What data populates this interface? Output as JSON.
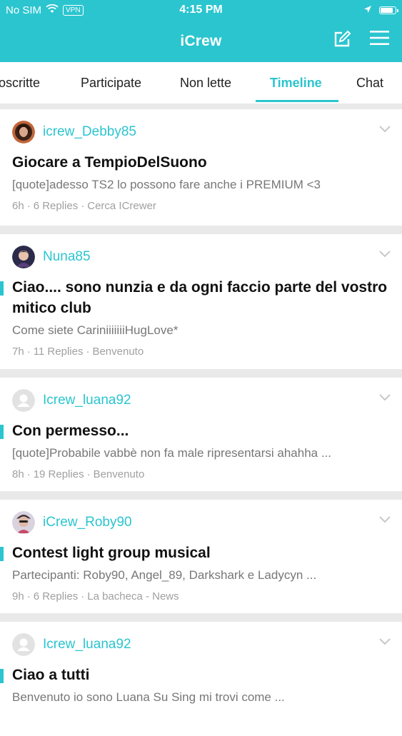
{
  "status_bar": {
    "carrier": "No SIM",
    "vpn": "VPN",
    "time": "4:15 PM",
    "battery_level": 0.75
  },
  "nav": {
    "title": "iCrew",
    "compose_icon": "compose-icon",
    "menu_icon": "hamburger-menu-icon"
  },
  "tabs": [
    "Iscritte",
    "Participate",
    "Non lette",
    "Timeline",
    "Chat"
  ],
  "tabs_display": [
    "oscritte",
    "Participate",
    "Non lette",
    "Timeline",
    "Chat"
  ],
  "active_tab": "Timeline",
  "colors": {
    "accent": "#2bc5cf"
  },
  "posts": [
    {
      "author": "icrew_Debby85",
      "title": "Giocare a TempioDelSuono",
      "snippet": "[quote]adesso TS2 lo possono fare anche i PREMIUM <3",
      "time": "6h",
      "replies": "6 Replies",
      "forum": "Cerca ICrewer",
      "unread": false
    },
    {
      "author": "Nuna85",
      "title": "Ciao.... sono nunzia e da ogni faccio parte del vostro mitico club",
      "snippet": "Come siete CariniiiiiiiHugLove*",
      "time": "7h",
      "replies": "11 Replies",
      "forum": "Benvenuto",
      "unread": true
    },
    {
      "author": "Icrew_luana92",
      "title": "Con permesso...",
      "snippet": "[quote]Probabile vabbè non fa male ripresentarsi ahahha ...",
      "time": "8h",
      "replies": "19 Replies",
      "forum": "Benvenuto",
      "unread": true
    },
    {
      "author": "iCrew_Roby90",
      "title": "Contest light group musical",
      "snippet": "Partecipanti: Roby90, Angel_89, Darkshark e Ladycyn  ...",
      "time": "9h",
      "replies": "6 Replies",
      "forum": "La bacheca - News",
      "unread": true
    },
    {
      "author": "Icrew_luana92",
      "title": "Ciao a tutti",
      "snippet": "Benvenuto io sono Luana Su Sing mi trovi come ...",
      "time": "",
      "replies": "",
      "forum": "",
      "unread": true
    }
  ]
}
